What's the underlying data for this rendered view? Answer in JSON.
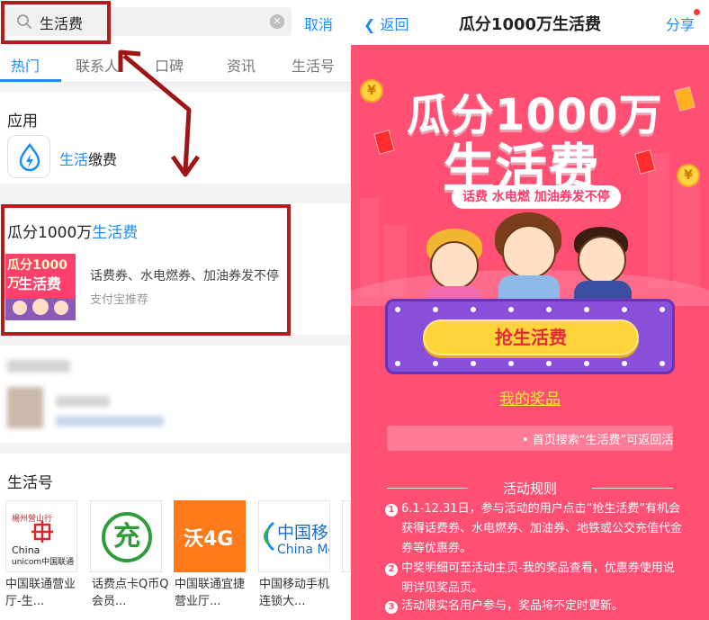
{
  "search": {
    "query": "生活费",
    "cancel_label": "取消",
    "tabs": [
      "热门",
      "联系人",
      "口碑",
      "资讯",
      "生活号"
    ]
  },
  "apps_section": {
    "title": "应用",
    "app_name_highlight": "生活",
    "app_name_rest": "缴费"
  },
  "promo": {
    "title_plain": "瓜分1000万",
    "title_highlight": "生活费",
    "thumb_line1": "瓜分1000万",
    "thumb_line2": "生活费",
    "desc": "话费券、水电燃券、加油券发不停",
    "source": "支付宝推荐"
  },
  "life_accounts": {
    "title": "生活号",
    "cards": [
      {
        "logo_line1": "China",
        "logo_line2": "unicom中国联通",
        "logo_top": "楊州營山行",
        "label": "中国联通营业厅-生..."
      },
      {
        "logo": "充",
        "label": "话费点卡Q币Q会员..."
      },
      {
        "logo": "沃4G",
        "label": "中国联通宜捷营业厅..."
      },
      {
        "logo_line1": "中国移",
        "logo_line2": "China Mo",
        "label": "中国移动手机连锁大..."
      }
    ]
  },
  "nav": {
    "back_label": "返回",
    "title": "瓜分1000万生活费",
    "share_label": "分享"
  },
  "hero": {
    "line1": "瓜分1000万",
    "line2": "生活费",
    "tagline": "话费 水电燃 加油券发不停",
    "coin_symbol": "¥"
  },
  "actions": {
    "grab_button": "抢生活费",
    "my_prize_link": "我的奖品",
    "marquee_text": "• 首页搜索“生活费”可返回活"
  },
  "rules": {
    "title": "活动规则",
    "items": [
      {
        "num": "1",
        "text": "6.1-12.31日，参与活动的用户点击“抢生活费”有机会获得话费券、水电燃券、加油券、地铁或公交充值代金券等优惠券。"
      },
      {
        "num": "2",
        "text": "中奖明细可至活动主页-我的奖品查看，优惠券使用说明详见奖品页。"
      },
      {
        "num": "3",
        "text": "活动限实名用户参与，奖品将不定时更新。"
      }
    ]
  },
  "colors": {
    "accent_blue": "#1a8cff",
    "annotation_red": "#b71c1c",
    "hero_pink": "#ff4f73",
    "button_yellow": "#ffd43b",
    "stage_purple": "#8a4fd8"
  }
}
